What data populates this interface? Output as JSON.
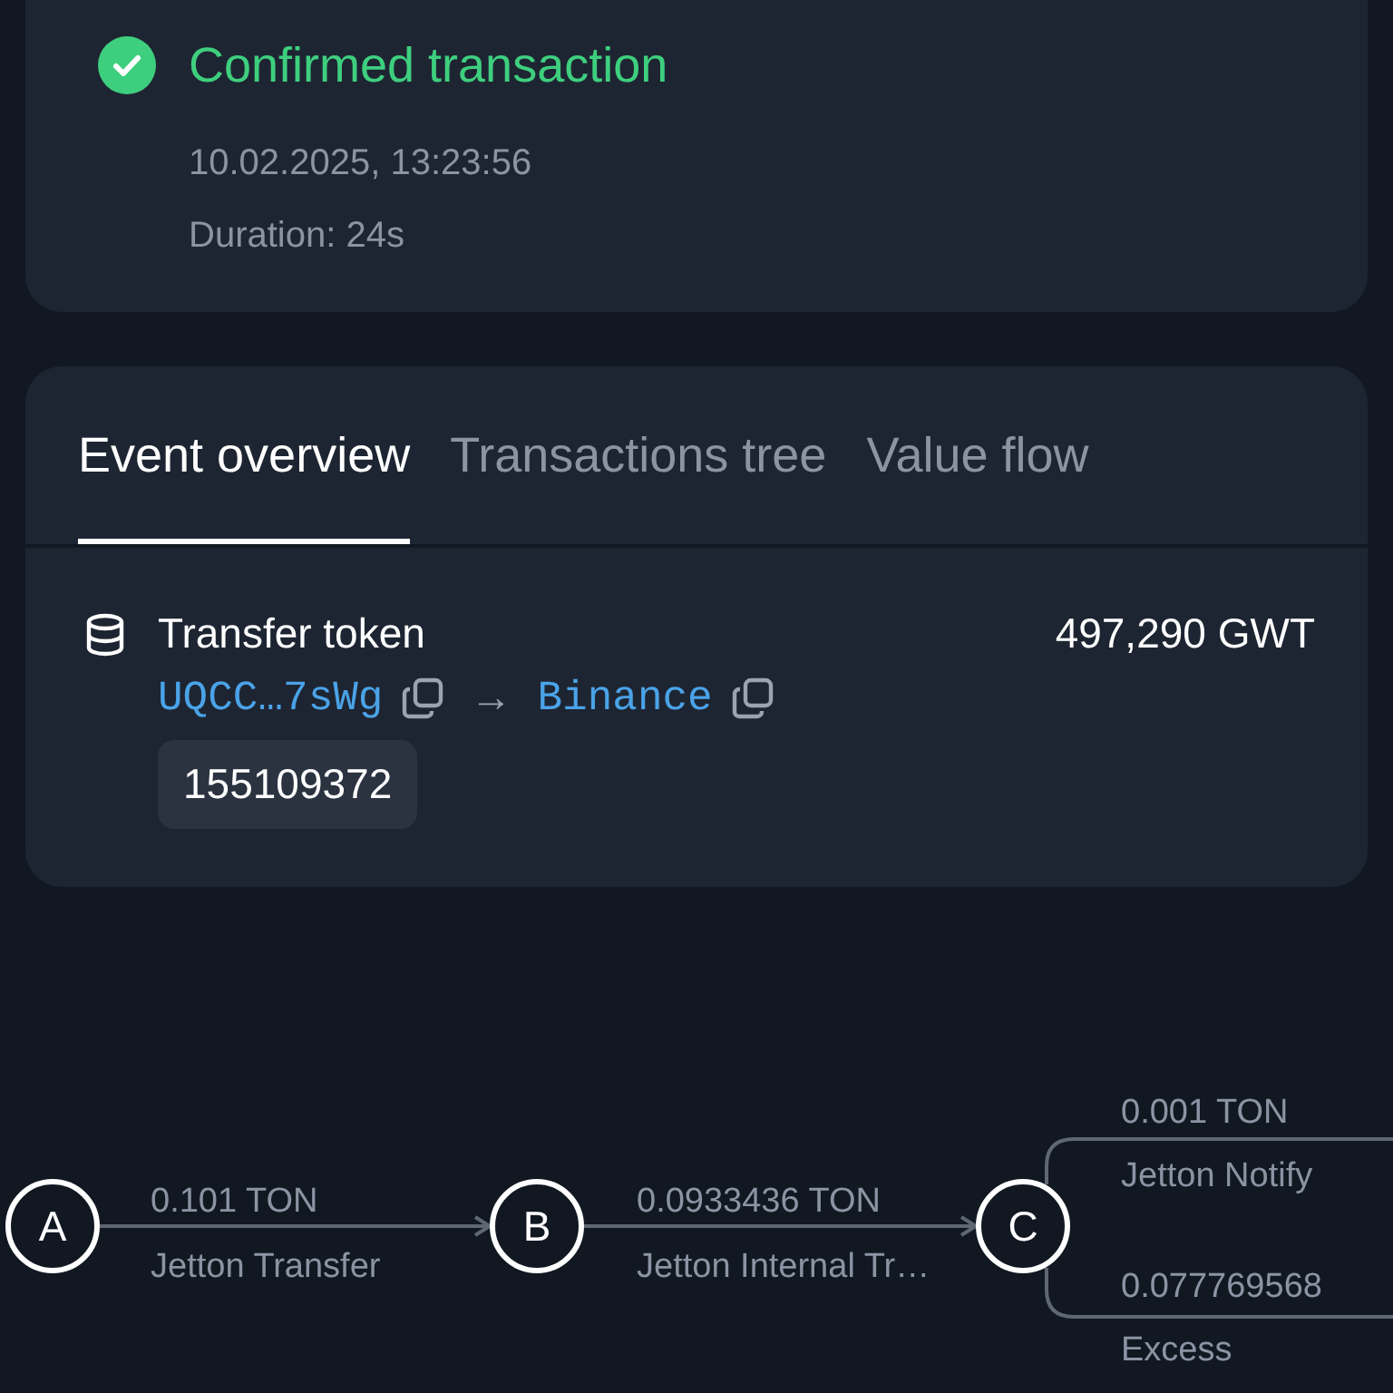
{
  "status": {
    "success": true,
    "title": "Confirmed transaction",
    "timestamp": "10.02.2025, 13:23:56",
    "duration": "Duration: 24s"
  },
  "tabs": [
    {
      "label": "Event overview",
      "selected": true
    },
    {
      "label": "Transactions tree",
      "selected": false
    },
    {
      "label": "Value flow",
      "selected": false
    }
  ],
  "event": {
    "title": "Transfer token",
    "amount": "497,290 GWT",
    "from": "UQCC…7sWg",
    "arrow": "→",
    "to": "Binance",
    "tag": "155109372"
  },
  "flow": {
    "nodes": [
      {
        "label": "A"
      },
      {
        "label": "B"
      },
      {
        "label": "C"
      }
    ],
    "edges": [
      {
        "amount": "0.101 TON",
        "operation": "Jetton Transfer"
      },
      {
        "amount": "0.0933436 TON",
        "operation": "Jetton Internal Tr…"
      }
    ],
    "branches": [
      {
        "amount": "0.001 TON",
        "operation": "Jetton Notify"
      },
      {
        "amount": "0.077769568",
        "operation": "Excess"
      }
    ]
  }
}
